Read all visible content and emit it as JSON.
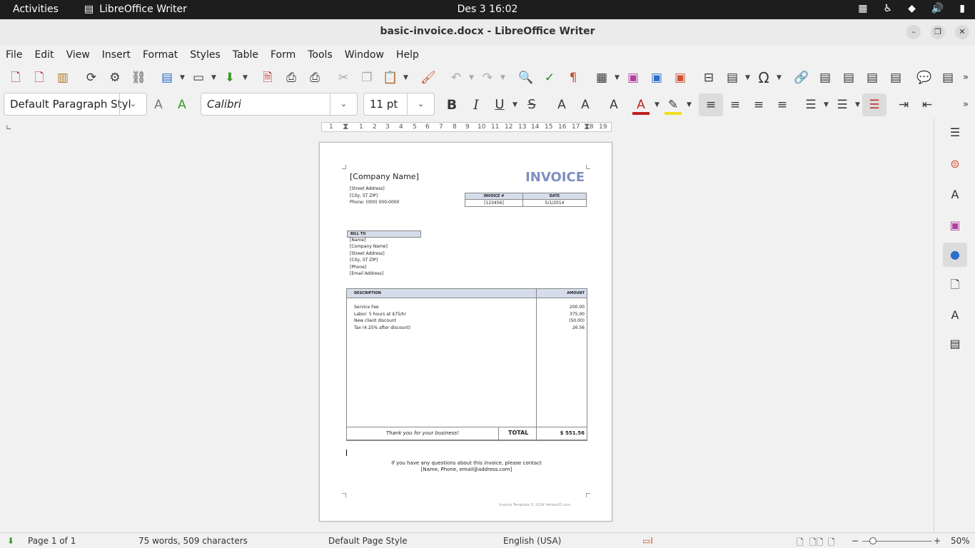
{
  "topbar": {
    "activities": "Activities",
    "app_name": "LibreOffice Writer",
    "clock": "Des 3  16:02"
  },
  "window": {
    "title": "basic-invoice.docx - LibreOffice Writer"
  },
  "menu": [
    "File",
    "Edit",
    "View",
    "Insert",
    "Format",
    "Styles",
    "Table",
    "Form",
    "Tools",
    "Window",
    "Help"
  ],
  "formatting": {
    "paragraph_style": "Default Paragraph Styl",
    "font_name": "Calibri",
    "font_size": "11 pt"
  },
  "ruler": [
    "1",
    "1",
    "2",
    "3",
    "4",
    "5",
    "6",
    "7",
    "8",
    "9",
    "10",
    "11",
    "12",
    "13",
    "14",
    "15",
    "16",
    "17",
    "18",
    "19"
  ],
  "invoice": {
    "company_name": "[Company Name]",
    "heading": "INVOICE",
    "street": "[Street Address]",
    "city": "[City, ST  ZIP]",
    "phone": "Phone: (000) 000-0000",
    "invoice_no_label": "INVOICE #",
    "date_label": "DATE",
    "invoice_no": "[123456]",
    "date": "5/1/2014",
    "bill_to_label": "BILL TO",
    "bill_to": [
      "[Name]",
      "[Company Name]",
      "[Street Address]",
      "[City, ST  ZIP]",
      "[Phone]",
      "[Email Address]"
    ],
    "desc_header": "DESCRIPTION",
    "amount_header": "AMOUNT",
    "items": [
      {
        "desc": "Service Fee",
        "amount": "200.00"
      },
      {
        "desc": "Labor: 5 hours at $75/hr",
        "amount": "375.00"
      },
      {
        "desc": "New client discount",
        "amount": "(50.00)"
      },
      {
        "desc": "Tax (4.25% after discount)",
        "amount": "26.56"
      }
    ],
    "thanks": "Thank you for your business!",
    "total_label": "TOTAL",
    "total_value": "$ 551.56",
    "contact_line1": "If you have any questions about this invoice, please contact",
    "contact_line2": "[Name, Phone, email@address.com]",
    "footer": "Invoice Template © 2014 Vertex42.com"
  },
  "status": {
    "page": "Page 1 of 1",
    "words": "75 words, 509 characters",
    "page_style": "Default Page Style",
    "language": "English (USA)",
    "zoom": "50%"
  }
}
